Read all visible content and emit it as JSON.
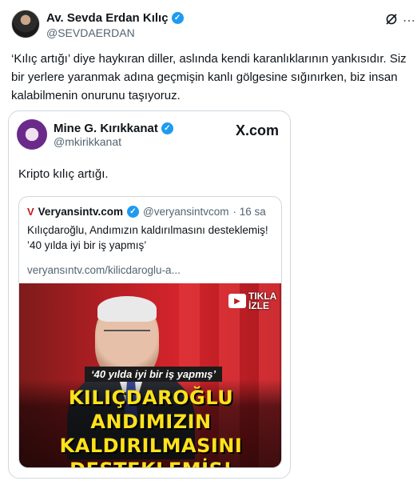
{
  "tweet": {
    "author_name": "Av. Sevda Erdan Kılıç",
    "author_handle": "@SEVDAERDAN",
    "text": "‘Kılıç artığı’ diye haykıran diller, aslında kendi karanlıklarının yankısıdır. Siz bir yerlere yaranmak adına geçmişin kanlı gölgesine sığınırken, biz insan kalabilmenin onurunu taşıyoruz."
  },
  "embedded": {
    "author_name": "Mine G. Kırıkkanat",
    "author_handle": "@mkirikkanat",
    "brand": "X.com",
    "text": "Kripto kılıç artığı.",
    "quote": {
      "logo": "V",
      "author_name": "Veryansintv.com",
      "author_handle": "@veryansintvcom",
      "time": "· 16 sa",
      "text": "Kılıçdaroğlu, Andımızın kaldırılmasını desteklemiş! ’40 yılda iyi bir iş yapmış’",
      "link": "veryansıntv.com/kilicdaroglu-a...",
      "image": {
        "cta_line1": "TIKLA",
        "cta_line2": "İZLE",
        "banner": "‘40 yılda iyi bir iş yapmış’",
        "headline_1": "KILIÇDAROĞLU",
        "headline_2": "ANDIMIZIN KALDIRILMASINI",
        "headline_3": "DESTEKLEMİŞ!"
      }
    }
  },
  "colors": {
    "verified": "#1d9bf0",
    "headline": "#ffe21a",
    "muted": "#536471"
  }
}
